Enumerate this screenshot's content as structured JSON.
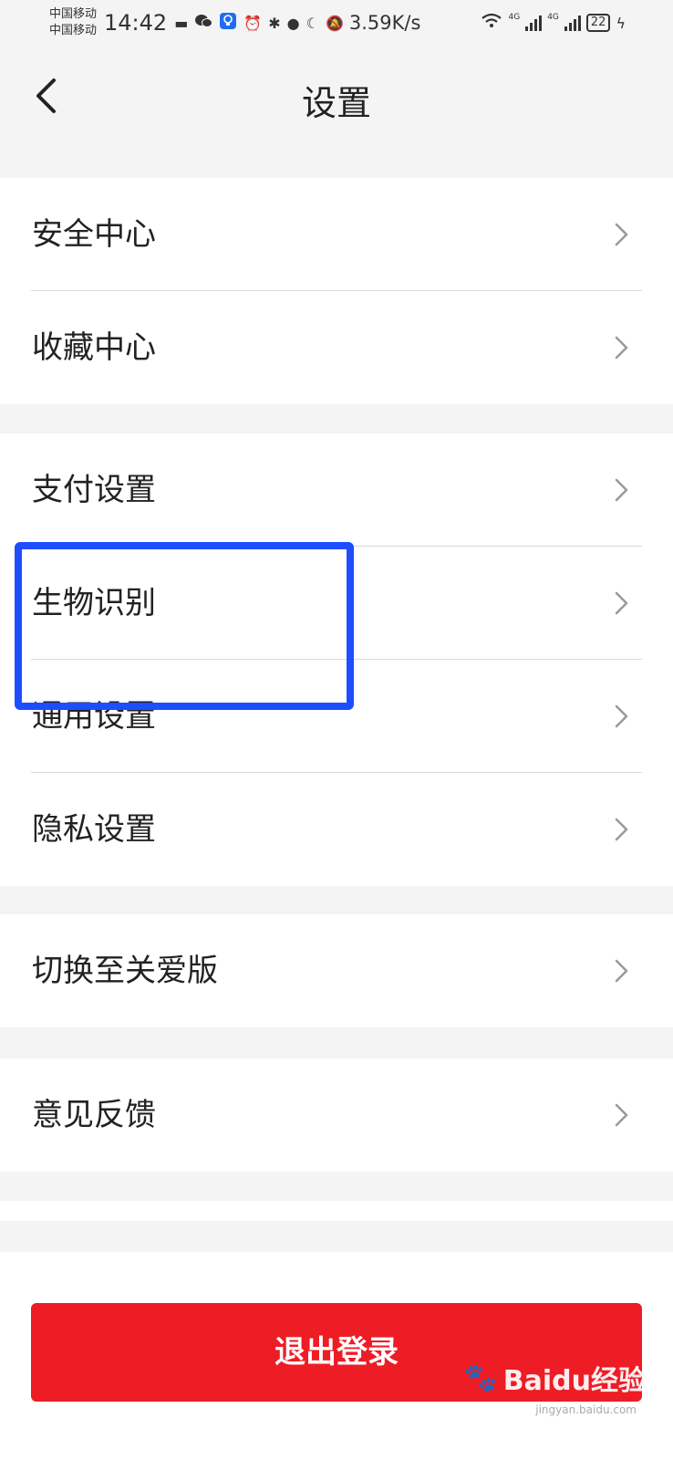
{
  "status_bar": {
    "carrier1": "中国移动",
    "carrier2": "中国移动",
    "time": "14:42",
    "net_speed": "3.59K/s",
    "net1": "4G",
    "net2": "4G",
    "battery": "22"
  },
  "header": {
    "title": "设置"
  },
  "groups": [
    {
      "items": [
        {
          "label": "安全中心"
        },
        {
          "label": "收藏中心"
        }
      ]
    },
    {
      "items": [
        {
          "label": "支付设置"
        },
        {
          "label": "生物识别"
        },
        {
          "label": "通用设置"
        },
        {
          "label": "隐私设置"
        }
      ]
    },
    {
      "items": [
        {
          "label": "切换至关爱版"
        }
      ]
    },
    {
      "items": [
        {
          "label": "意见反馈"
        }
      ]
    }
  ],
  "logout": {
    "label": "退出登录"
  },
  "watermark": {
    "brand": "Baidu经验",
    "domain": "jingyan.baidu.com"
  },
  "colors": {
    "accent": "#ee1c25",
    "highlight": "#1e4dff",
    "background": "#f4f4f4"
  }
}
